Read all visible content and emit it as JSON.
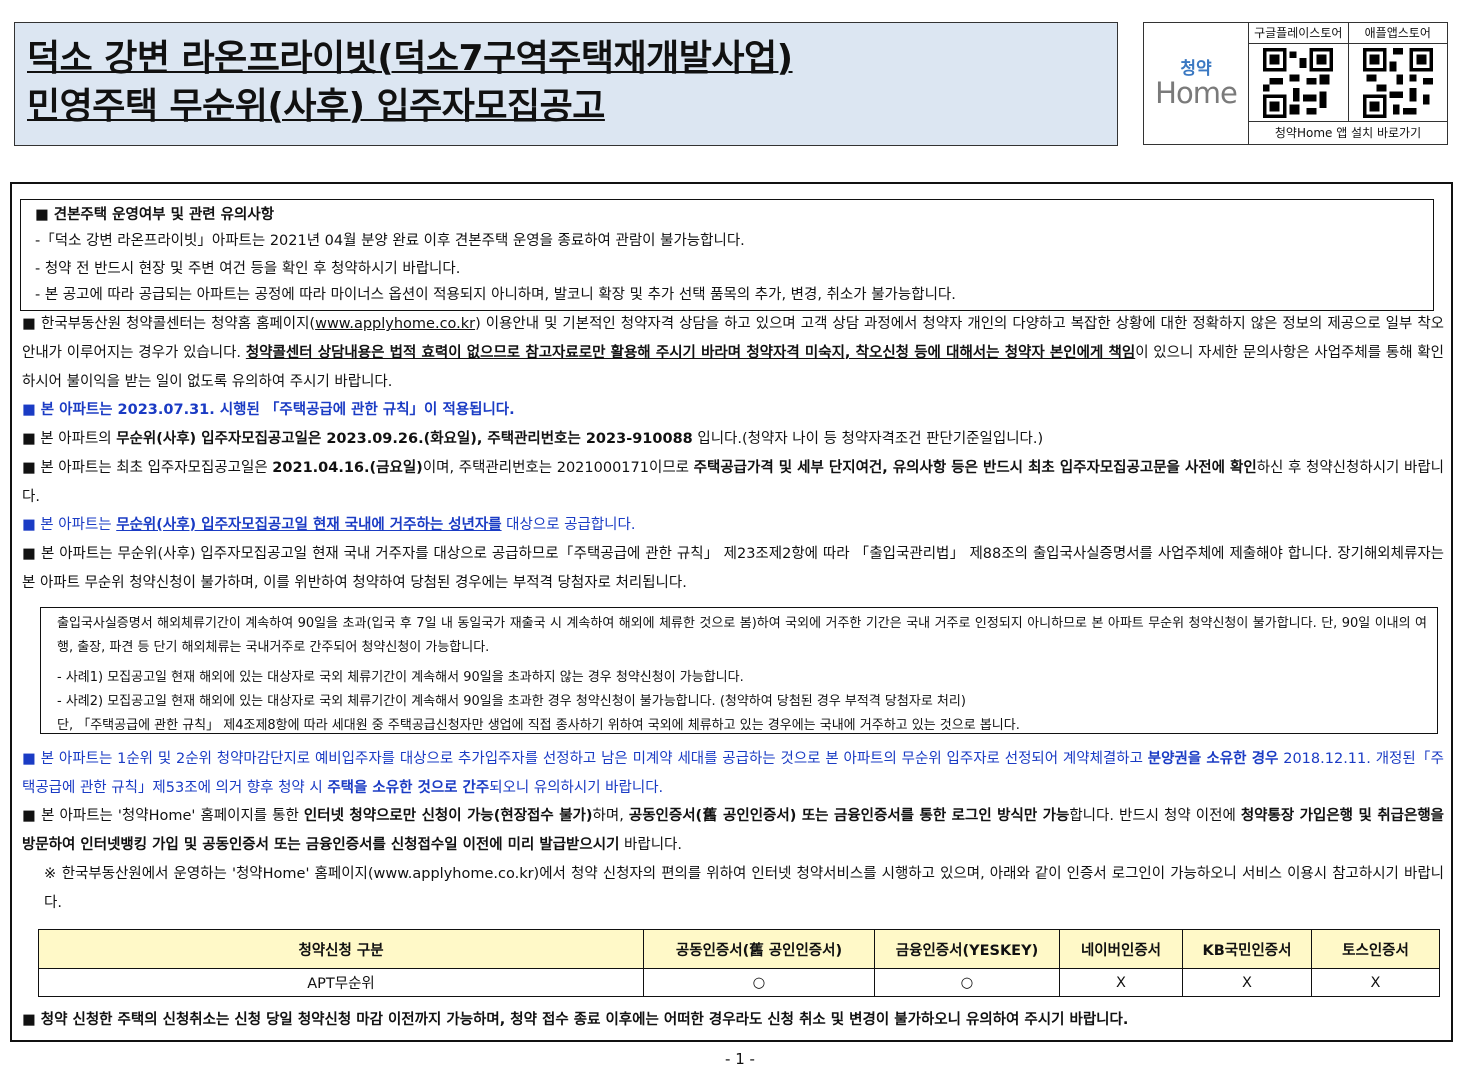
{
  "title": {
    "line1": "덕소 강변 라온프라이빗(덕소7구역주택재개발사업)",
    "line2": "민영주택 무순위(사후) 입주자모집공고"
  },
  "app_box": {
    "logo_top": "청약",
    "logo_bottom": "Home",
    "google_label": "구글플레이스토어",
    "apple_label": "애플앱스토어",
    "install_link": "청약Home 앱 설치 바로가기"
  },
  "model_house": {
    "title": "■ 견본주택 운영여부 및 관련 유의사항",
    "items": [
      "-「덕소 강변 라온프라이빗」아파트는 2021년 04월 분양 완료 이후 견본주택 운영을 종료하여 관람이 불가능합니다.",
      "- 청약 전 반드시 현장 및 주변 여건 등을 확인 후 청약하시기 바랍니다.",
      "- 본 공고에 따라 공급되는 아파트는 공정에 따라 마이너스 옵션이 적용되지 아니하며, 발코니 확장 및 추가 선택 품목의 추가, 변경, 취소가 불가능합니다."
    ]
  },
  "p1": {
    "a": "■ 한국부동산원 청약콜센터는 청약홈 홈페이지(",
    "link": "www.applyhome.co.kr",
    "b": ") 이용안내 및 기본적인 청약자격 상담을 하고 있으며 고객 상담 과정에서 청약자 개인의 다양하고 복잡한 상황에 대한 정확하지 않은 정보의 제공으로 일부 착오 안내가 이루어지는 경우가 있습니다. ",
    "bold": "청약콜센터 상담내용은 법적 효력이 없으므로 참고자료로만 활용해 주시기 바라며 청약자격 미숙지, 착오신청 등에 대해서는 청약자 본인에게 책임",
    "c": "이 있으니 자세한 문의사항은 사업주체를 통해 확인하시어 불이익을 받는 일이 없도록 유의하여 주시기 바랍니다."
  },
  "p2": "■ 본 아파트는 2023.07.31. 시행된 「주택공급에 관한 규칙」이 적용됩니다.",
  "p3": {
    "a": "■ 본 아파트의 ",
    "bold": "무순위(사후) 입주자모집공고일은 2023.09.26.(화요일), 주택관리번호는 2023-910088",
    "c": " 입니다.(청약자 나이 등 청약자격조건 판단기준일입니다.)"
  },
  "p4": {
    "a": "■ 본 아파트는 최초 입주자모집공고일은 ",
    "bold1": "2021.04.16.(금요일)",
    "b": "이며, 주택관리번호는 2021000171이므로 ",
    "bold2": "주택공급가격 및 세부 단지여건, 유의사항 등은 반드시 최초 입주자모집공고문을 사전에 확인",
    "c": "하신 후 청약신청하시기 바랍니다."
  },
  "p5": {
    "a": "■ 본 아파트는 ",
    "bold": "무순위(사후) 입주자모집공고일 현재 국내에 거주하는 성년자를",
    "c": " 대상으로 공급합니다."
  },
  "p6": "■ 본 아파트는 무순위(사후) 입주자모집공고일 현재 국내 거주자를 대상으로 공급하므로「주택공급에 관한 규칙」 제23조제2항에 따라 「출입국관리법」 제88조의 출입국사실증명서를 사업주체에 제출해야 합니다. 장기해외체류자는 본 아파트 무순위 청약신청이 불가하며, 이를 위반하여 청약하여 당첨된 경우에는 부적격 당첨자로 처리됩니다.",
  "note": {
    "line1": "출입국사실증명서 해외체류기간이 계속하여 90일을 초과(입국 후 7일 내 동일국가 재출국 시 계속하여 해외에 체류한 것으로 봄)하여 국외에 거주한 기간은 국내 거주로 인정되지 아니하므로 본 아파트 무순위 청약신청이 불가합니다. 단, 90일 이내의 여행, 출장, 파견 등 단기 해외체류는 국내거주로 간주되어 청약신청이 가능합니다.",
    "case1": "- 사례1) 모집공고일 현재 해외에 있는 대상자로 국외 체류기간이 계속해서 90일을 초과하지 않는 경우 청약신청이 가능합니다.",
    "case2": "- 사례2) 모집공고일 현재 해외에 있는 대상자로 국외 체류기간이 계속해서 90일을 초과한 경우 청약신청이 불가능합니다. (청약하여 당첨된 경우 부적격 당첨자로 처리)",
    "line2": "단, 「주택공급에 관한 규칙」 제4조제8항에 따라 세대원 중 주택공급신청자만 생업에 직접 종사하기 위하여 국외에 체류하고 있는 경우에는 국내에 거주하고 있는 것으로 봅니다."
  },
  "p7": {
    "a": "■ 본 아파트는 1순위 및 2순위 청약마감단지로 예비입주자를 대상으로 추가입주자를 선정하고 남은 미계약 세대를 공급하는 것으로 본 아파트의 무순위 입주자로 선정되어 계약체결하고 ",
    "bold1": "분양권을 소유한 경우",
    "b": " 2018.12.11. 개정된「주택공급에 관한 규칙」제53조에 의거 향후 청약 시 ",
    "bold2": "주택을 소유한 것으로 간주",
    "c": "되오니 유의하시기 바랍니다."
  },
  "p8": {
    "a": "■ 본 아파트는 '청약Home' 홈페이지를 통한 ",
    "bold1": "인터넷 청약으로만 신청이 가능(현장접수 불가)",
    "b": "하며, ",
    "bold2": "공동인증서(舊 공인인증서) 또는 금융인증서를 통한 로그인 방식만 가능",
    "c": "합니다. 반드시 청약 이전에 ",
    "bold3": "청약통장 가입은행 및 취급은행을 방문하여 인터넷뱅킹 가입 및 공동인증서 또는 금융인증서를 신청접수일 이전에 미리 발급받으시기",
    "d": " 바랍니다."
  },
  "p9": "※ 한국부동산원에서 운영하는 '청약Home' 홈페이지(www.applyhome.co.kr)에서 청약 신청자의 편의를 위하여 인터넷 청약서비스를 시행하고 있으며, 아래와 같이 인증서 로그인이 가능하오니 서비스 이용시 참고하시기 바랍니다.",
  "table": {
    "headers": [
      "청약신청 구분",
      "공동인증서(舊 공인인증서)",
      "금융인증서(YESKEY)",
      "네이버인증서",
      "KB국민인증서",
      "토스인증서"
    ],
    "row": [
      "APT무순위",
      "○",
      "○",
      "X",
      "X",
      "X"
    ]
  },
  "p10": "■ 청약 신청한 주택의 신청취소는 신청 당일 청약신청 마감 이전까지 가능하며, 청약 접수 종료 이후에는 어떠한 경우라도 신청 취소 및 변경이 불가하오니 유의하여 주시기 바랍니다.",
  "page_number": "- 1 -",
  "colors": {
    "blue": "#1a3bc4",
    "title_bg": "#dce6f2",
    "table_head_bg": "#fff9c8"
  }
}
